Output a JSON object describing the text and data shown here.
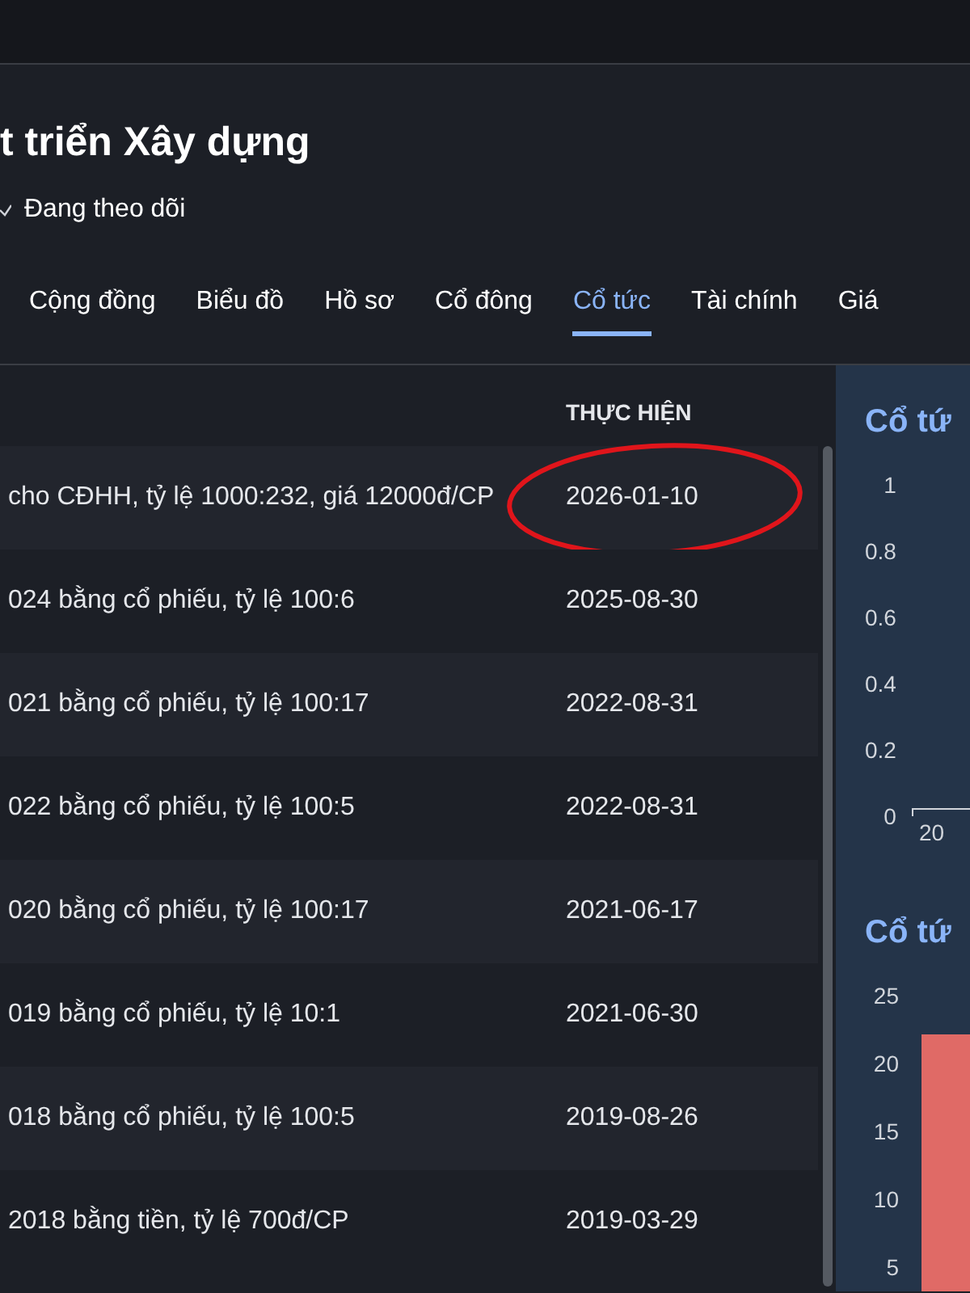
{
  "header": {
    "title": "t triển Xây dựng",
    "follow_label": "Đang theo dõi"
  },
  "tabs": [
    {
      "label": "Cộng đồng",
      "selected": false
    },
    {
      "label": "Biểu đồ",
      "selected": false
    },
    {
      "label": "Hồ sơ",
      "selected": false
    },
    {
      "label": "Cổ đông",
      "selected": false
    },
    {
      "label": "Cổ tức",
      "selected": true
    },
    {
      "label": "Tài chính",
      "selected": false
    },
    {
      "label": "Giá",
      "selected": false
    }
  ],
  "table": {
    "columns": [
      "THỰC HIỆN"
    ],
    "rows": [
      {
        "event": "cho CĐHH, tỷ lệ 1000:232, giá 12000đ/CP",
        "date": "2026-01-10",
        "circled": true
      },
      {
        "event": "024 bằng cổ phiếu, tỷ lệ 100:6",
        "date": "2025-08-30",
        "circled": false
      },
      {
        "event": "021 bằng cổ phiếu, tỷ lệ 100:17",
        "date": "2022-08-31",
        "circled": false
      },
      {
        "event": "022 bằng cổ phiếu, tỷ lệ 100:5",
        "date": "2022-08-31",
        "circled": false
      },
      {
        "event": "020 bằng cổ phiếu, tỷ lệ 100:17",
        "date": "2021-06-17",
        "circled": false
      },
      {
        "event": "019 bằng cổ phiếu, tỷ lệ 10:1",
        "date": "2021-06-30",
        "circled": false
      },
      {
        "event": "018 bằng cổ phiếu, tỷ lệ 100:5",
        "date": "2019-08-26",
        "circled": false
      },
      {
        "event": "2018 bằng tiền, tỷ lệ 700đ/CP",
        "date": "2019-03-29",
        "circled": false
      }
    ]
  },
  "charts": [
    {
      "title": "Cổ tứ",
      "y_labels": [
        "1",
        "0.8",
        "0.6",
        "0.4",
        "0.2",
        "0"
      ],
      "x_labels": [
        "20"
      ],
      "kind": "line"
    },
    {
      "title": "Cổ tứ",
      "y_labels": [
        "25",
        "20",
        "15",
        "10",
        "5"
      ],
      "kind": "bar"
    }
  ]
}
